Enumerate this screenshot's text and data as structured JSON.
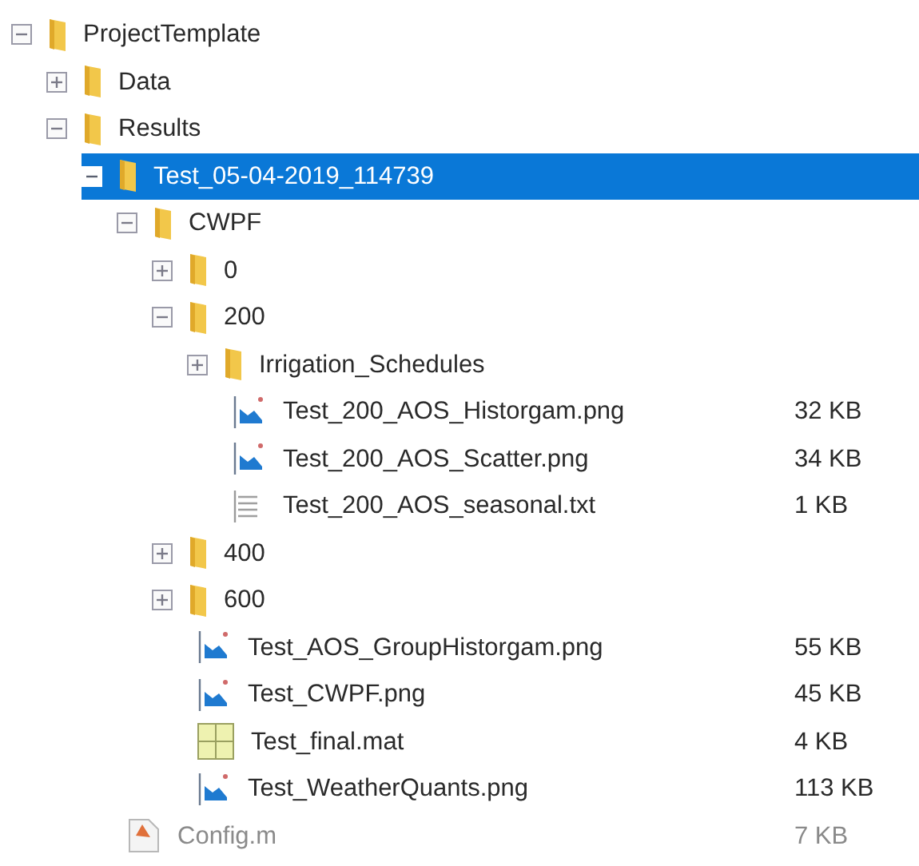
{
  "tree": [
    {
      "label": "ProjectTemplate",
      "kind": "folder",
      "expanded": true,
      "selected": false,
      "dimmed": false,
      "children": [
        {
          "label": "Data",
          "kind": "folder",
          "expanded": false,
          "selected": false,
          "dimmed": false
        },
        {
          "label": "Results",
          "kind": "folder",
          "expanded": true,
          "selected": false,
          "dimmed": false,
          "children": [
            {
              "label": "Test_05-04-2019_114739",
              "kind": "folder",
              "expanded": true,
              "selected": true,
              "dimmed": false,
              "children": [
                {
                  "label": "CWPF",
                  "kind": "folder",
                  "expanded": true,
                  "selected": false,
                  "dimmed": false,
                  "children": [
                    {
                      "label": "0",
                      "kind": "folder",
                      "expanded": false,
                      "selected": false,
                      "dimmed": false
                    },
                    {
                      "label": "200",
                      "kind": "folder",
                      "expanded": true,
                      "selected": false,
                      "dimmed": false,
                      "children": [
                        {
                          "label": "Irrigation_Schedules",
                          "kind": "folder",
                          "expanded": false,
                          "selected": false,
                          "dimmed": false
                        },
                        {
                          "label": "Test_200_AOS_Historgam.png",
                          "kind": "image",
                          "size": "32 KB",
                          "selected": false,
                          "dimmed": false
                        },
                        {
                          "label": "Test_200_AOS_Scatter.png",
                          "kind": "image",
                          "size": "34 KB",
                          "selected": false,
                          "dimmed": false
                        },
                        {
                          "label": "Test_200_AOS_seasonal.txt",
                          "kind": "text",
                          "size": "1 KB",
                          "selected": false,
                          "dimmed": false
                        }
                      ]
                    },
                    {
                      "label": "400",
                      "kind": "folder",
                      "expanded": false,
                      "selected": false,
                      "dimmed": false
                    },
                    {
                      "label": "600",
                      "kind": "folder",
                      "expanded": false,
                      "selected": false,
                      "dimmed": false
                    },
                    {
                      "label": "Test_AOS_GroupHistorgam.png",
                      "kind": "image",
                      "size": "55 KB",
                      "selected": false,
                      "dimmed": false
                    },
                    {
                      "label": "Test_CWPF.png",
                      "kind": "image",
                      "size": "45 KB",
                      "selected": false,
                      "dimmed": false
                    },
                    {
                      "label": "Test_final.mat",
                      "kind": "mat",
                      "size": "4 KB",
                      "selected": false,
                      "dimmed": false
                    },
                    {
                      "label": "Test_WeatherQuants.png",
                      "kind": "image",
                      "size": "113 KB",
                      "selected": false,
                      "dimmed": false
                    }
                  ]
                }
              ]
            },
            {
              "label": "Config.m",
              "kind": "script",
              "size": "7 KB",
              "selected": false,
              "dimmed": true
            }
          ]
        }
      ]
    }
  ]
}
